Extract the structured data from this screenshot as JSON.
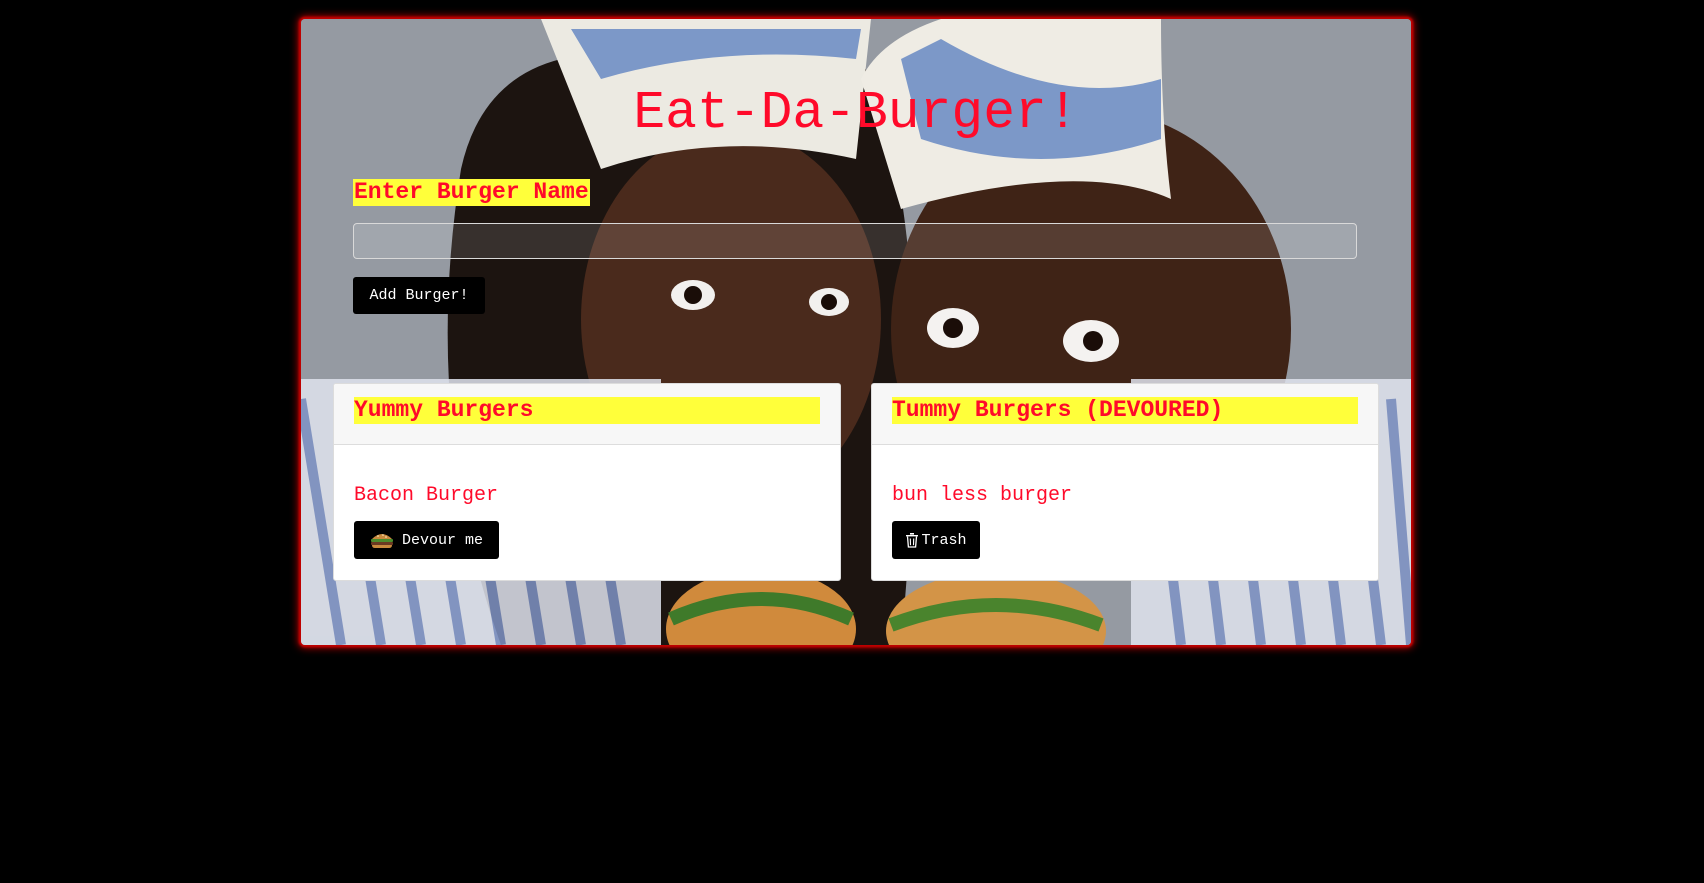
{
  "app": {
    "title": "Eat-Da-Burger!"
  },
  "form": {
    "label": "Enter Burger Name",
    "input_value": "",
    "input_placeholder": "",
    "submit_label": "Add Burger!"
  },
  "columns": {
    "yummy": {
      "title": "Yummy Burgers",
      "items": [
        {
          "name": "Bacon Burger",
          "action_label": "Devour me",
          "action_icon": "burger-icon"
        }
      ]
    },
    "devoured": {
      "title": "Tummy Burgers (DEVOURED)",
      "items": [
        {
          "name": "bun less burger",
          "action_label": "Trash",
          "action_icon": "trash-icon"
        }
      ]
    }
  },
  "colors": {
    "accent_text": "#ff0a2a",
    "highlight": "#ffff3a",
    "button_bg": "#000000",
    "frame_glow": "#b00000"
  }
}
